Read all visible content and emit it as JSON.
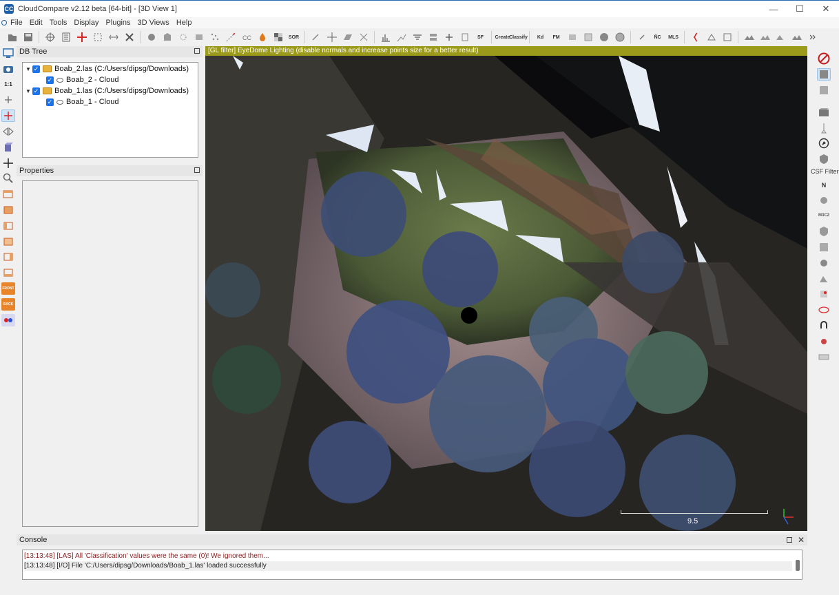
{
  "window": {
    "title": "CloudCompare v2.12 beta [64-bit] - [3D View 1]",
    "app_icon": "CC",
    "controls": {
      "minimize": "—",
      "maximize": "☐",
      "close": "✕"
    }
  },
  "menu": {
    "items": [
      "File",
      "Edit",
      "Tools",
      "Display",
      "Plugins",
      "3D Views",
      "Help"
    ]
  },
  "toolbar": {
    "labels": {
      "sor": "SOR",
      "sf_color": "SF",
      "canupo_create": "Create",
      "canupo_classify": "Classify",
      "kd": "Kd",
      "fm": "FM",
      "nc": "ÑC",
      "mls": "MLS"
    }
  },
  "left_tools": {
    "items": [
      "view-icon",
      "camera-icon",
      "one-to-one-icon",
      "plus-icon",
      "auto-pick-icon",
      "point-picking-icon",
      "cube-icon",
      "crosshair-icon",
      "zoom-icon",
      "top-view-icon",
      "front-view-icon",
      "left-view-icon",
      "right-view-icon",
      "iso-view-icon",
      "back-iso-view-icon",
      "front-box-icon",
      "back-box-icon",
      "stereo-icon"
    ],
    "one_to_one": "1:1",
    "front": "FRONT",
    "back": "BACK"
  },
  "db_tree": {
    "title": "DB Tree",
    "rows": [
      {
        "label": "Boab_2.las (C:/Users/dipsg/Downloads)",
        "type": "folder"
      },
      {
        "label": "Boab_2 - Cloud",
        "type": "cloud"
      },
      {
        "label": "Boab_1.las (C:/Users/dipsg/Downloads)",
        "type": "folder"
      },
      {
        "label": "Boab_1 - Cloud",
        "type": "cloud"
      }
    ]
  },
  "properties": {
    "title": "Properties"
  },
  "viewport": {
    "gl_filter": "[GL filter] EyeDome Lighting (disable normals and increase points size for a better result)",
    "scale_value": "9.5",
    "axes": {
      "x": "X",
      "y": "Y",
      "z": "Z"
    }
  },
  "right_tools": {
    "csf_label": "CSF Filter",
    "m3c2": "M3C2",
    "n_label": "N"
  },
  "console": {
    "title": "Console",
    "lines": [
      {
        "text": "[13:13:48] [LAS] All 'Classification' values were the same (0)! We ignored them...",
        "level": "warning"
      },
      {
        "text": "[13:13:48] [I/O] File 'C:/Users/dipsg/Downloads/Boab_1.las' loaded successfully",
        "level": "info"
      }
    ]
  },
  "colors": {
    "gl_header_bg": "#9c9a1a",
    "checkbox": "#1a73e8",
    "folder": "#e9b23b",
    "warning_text": "#8b1a1a",
    "viewport_bg": "#0a0a0c"
  }
}
